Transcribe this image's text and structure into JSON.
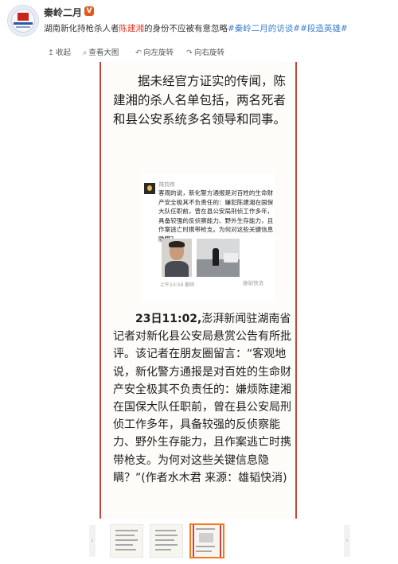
{
  "post": {
    "username": "秦岭二月",
    "verified_badge": "V",
    "headline_pre": "湖南新化持枪杀人者",
    "headline_name": "陈建湘",
    "headline_post": "的身份不应被有意忽略",
    "hashtag1": "#秦岭二月的访谈#",
    "hashtag2": "#段造英雄#"
  },
  "toolbar": {
    "collapse": "收起",
    "view_large": "查看大图",
    "rotate_left": "向左旋转",
    "rotate_right": "向右旋转"
  },
  "article": {
    "para1": "据未经官方证实的传闻，陈建湘的杀人名单包括，两名死者和县公安系统多名领导和同事。",
    "para2_bold": "23日11:02,",
    "para2_rest": "澎湃新闻驻湖南省记者对新化县公安局悬赏公告有所批评。该记者在朋友圈留言：“客观地说，新化警方通报是对百姓的生命财产安全极其不负责任的：嫌烦陈建湘在国保大队任职前，曾在县公安局刑侦工作多年，具备较强的反侦察能力、野外生存能力，且作案逃亡时携带枪支。为何对这些关键信息隐瞒？”(作者水木君 来源：雄韬快消)"
  },
  "inner_screenshot": {
    "name": "陈钧伟",
    "text": "客观的说，新化警方通报是对百姓的生命财产安全极其不负责任的：嫌犯陈建湘在国保大队任职前，曾在县公安局刑侦工作多年，具备较强的反侦察能力、野外生存能力，且作案逃亡时携带枪支。为何对这些关键信息隐瞒？",
    "time": "上午10:59  删除",
    "watermark": "雄韬快消"
  },
  "thumbnails": {
    "prev_arrow": "‹",
    "next_arrow": "›",
    "active_index": 3
  },
  "colors": {
    "highlight": "#e03a2c",
    "hashtag": "#3d7ccf",
    "frame_border": "#c7463a",
    "active_thumb": "#f47a20"
  }
}
